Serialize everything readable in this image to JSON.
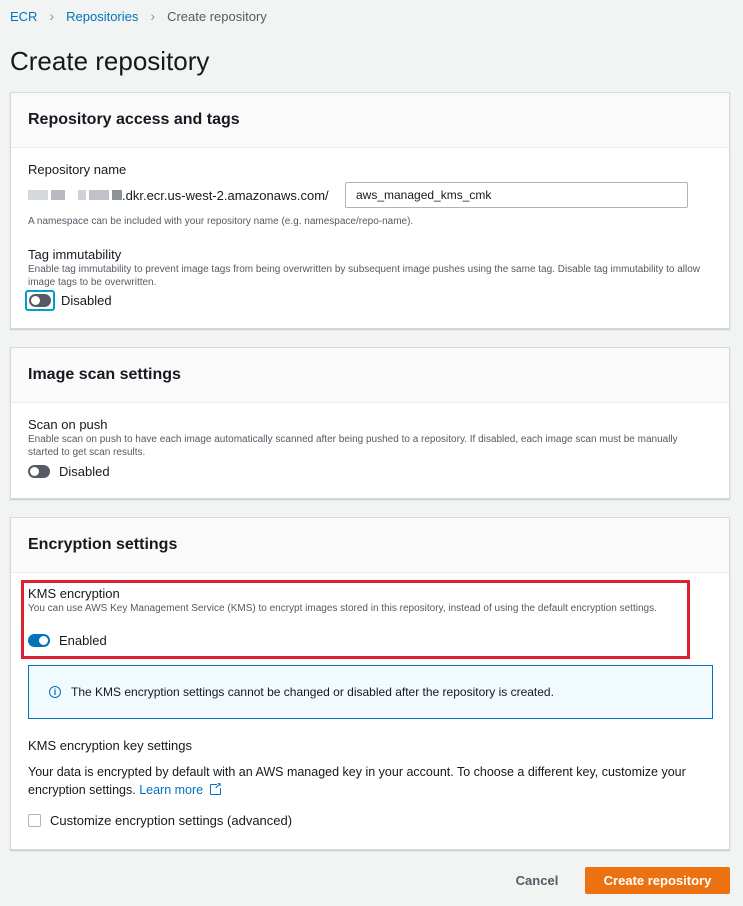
{
  "breadcrumb": {
    "items": [
      "ECR",
      "Repositories"
    ],
    "current": "Create repository"
  },
  "page_title": "Create repository",
  "access_panel": {
    "title": "Repository access and tags",
    "repo_name_label": "Repository name",
    "uri_suffix": ".dkr.ecr.us-west-2.amazonaws.com/",
    "repo_name_value": "aws_managed_kms_cmk",
    "repo_name_hint": "A namespace can be included with your repository name (e.g. namespace/repo-name).",
    "tag_immutability_label": "Tag immutability",
    "tag_immutability_desc": "Enable tag immutability to prevent image tags from being overwritten by subsequent image pushes using the same tag. Disable tag immutability to allow image tags to be overwritten.",
    "tag_immutability_state": "Disabled"
  },
  "scan_panel": {
    "title": "Image scan settings",
    "scan_label": "Scan on push",
    "scan_desc": "Enable scan on push to have each image automatically scanned after being pushed to a repository. If disabled, each image scan must be manually started to get scan results.",
    "scan_state": "Disabled"
  },
  "encryption_panel": {
    "title": "Encryption settings",
    "kms_label": "KMS encryption",
    "kms_desc": "You can use AWS Key Management Service (KMS) to encrypt images stored in this repository, instead of using the default encryption settings.",
    "kms_state": "Enabled",
    "info_text": "The KMS encryption settings cannot be changed or disabled after the repository is created.",
    "key_settings_label": "KMS encryption key settings",
    "key_settings_desc": "Your data is encrypted by default with an AWS managed key in your account. To choose a different key, customize your encryption settings.",
    "learn_more": "Learn more",
    "customize_label": "Customize encryption settings (advanced)"
  },
  "actions": {
    "cancel": "Cancel",
    "create": "Create repository"
  },
  "colors": {
    "primary": "#ec7211",
    "link": "#0073bb",
    "highlight_box": "#e0202e",
    "info_border": "#0073bb"
  }
}
